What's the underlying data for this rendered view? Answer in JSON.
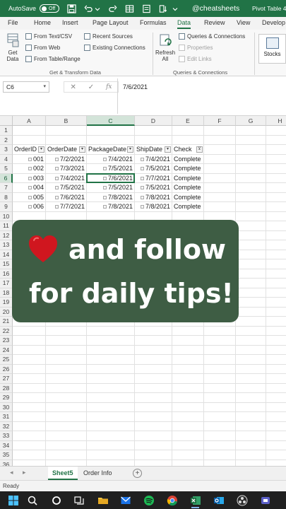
{
  "titlebar": {
    "autosave_label": "AutoSave",
    "autosave_state": "Off",
    "handle": "@cheatsheets",
    "window_title": "Pivot Table 4"
  },
  "ribbon_tabs": [
    "File",
    "Home",
    "Insert",
    "Page Layout",
    "Formulas",
    "Data",
    "Review",
    "View",
    "Develop"
  ],
  "active_tab": "Data",
  "ribbon": {
    "get_data": "Get Data",
    "from_text_csv": "From Text/CSV",
    "from_web": "From Web",
    "from_table_range": "From Table/Range",
    "recent_sources": "Recent Sources",
    "existing_connections": "Existing Connections",
    "get_transform_label": "Get & Transform Data",
    "refresh_all": "Refresh All",
    "queries_connections": "Queries & Connections",
    "properties": "Properties",
    "edit_links": "Edit Links",
    "queries_label": "Queries & Connections",
    "stocks": "Stocks"
  },
  "formula_bar": {
    "name_box": "C6",
    "value": "7/6/2021",
    "fx": "fx"
  },
  "grid": {
    "columns": [
      "A",
      "B",
      "C",
      "D",
      "E",
      "F",
      "G",
      "H"
    ],
    "selected_column": "C",
    "selected_row": 6,
    "row_numbers": [
      1,
      2,
      3,
      4,
      5,
      6,
      7,
      8,
      9,
      10,
      11,
      12,
      13,
      14,
      15,
      16,
      17,
      18,
      19,
      20,
      21,
      22,
      23,
      24,
      25,
      26,
      27,
      28,
      29,
      30,
      31,
      32,
      33,
      34,
      35,
      36
    ],
    "headers": [
      "OrderID",
      "OrderDate",
      "PackageDate",
      "ShipDate",
      "Check"
    ],
    "rows": [
      [
        "001",
        "7/2/2021",
        "7/4/2021",
        "7/4/2021",
        "Complete"
      ],
      [
        "002",
        "7/3/2021",
        "7/5/2021",
        "7/5/2021",
        "Complete"
      ],
      [
        "003",
        "7/4/2021",
        "7/6/2021",
        "7/7/2021",
        "Complete"
      ],
      [
        "004",
        "7/5/2021",
        "7/5/2021",
        "7/5/2021",
        "Complete"
      ],
      [
        "005",
        "7/6/2021",
        "7/8/2021",
        "7/8/2021",
        "Complete"
      ],
      [
        "006",
        "7/7/2021",
        "7/8/2021",
        "7/8/2021",
        "Complete"
      ]
    ]
  },
  "overlay": {
    "line1": "and follow",
    "line2": "for daily tips!"
  },
  "sheets": [
    "Sheet5",
    "Order Info"
  ],
  "active_sheet": "Sheet5",
  "status": "Ready",
  "colors": {
    "excel_green": "#217346",
    "overlay_bg": "#3e5d44",
    "heart": "#d0161f"
  }
}
